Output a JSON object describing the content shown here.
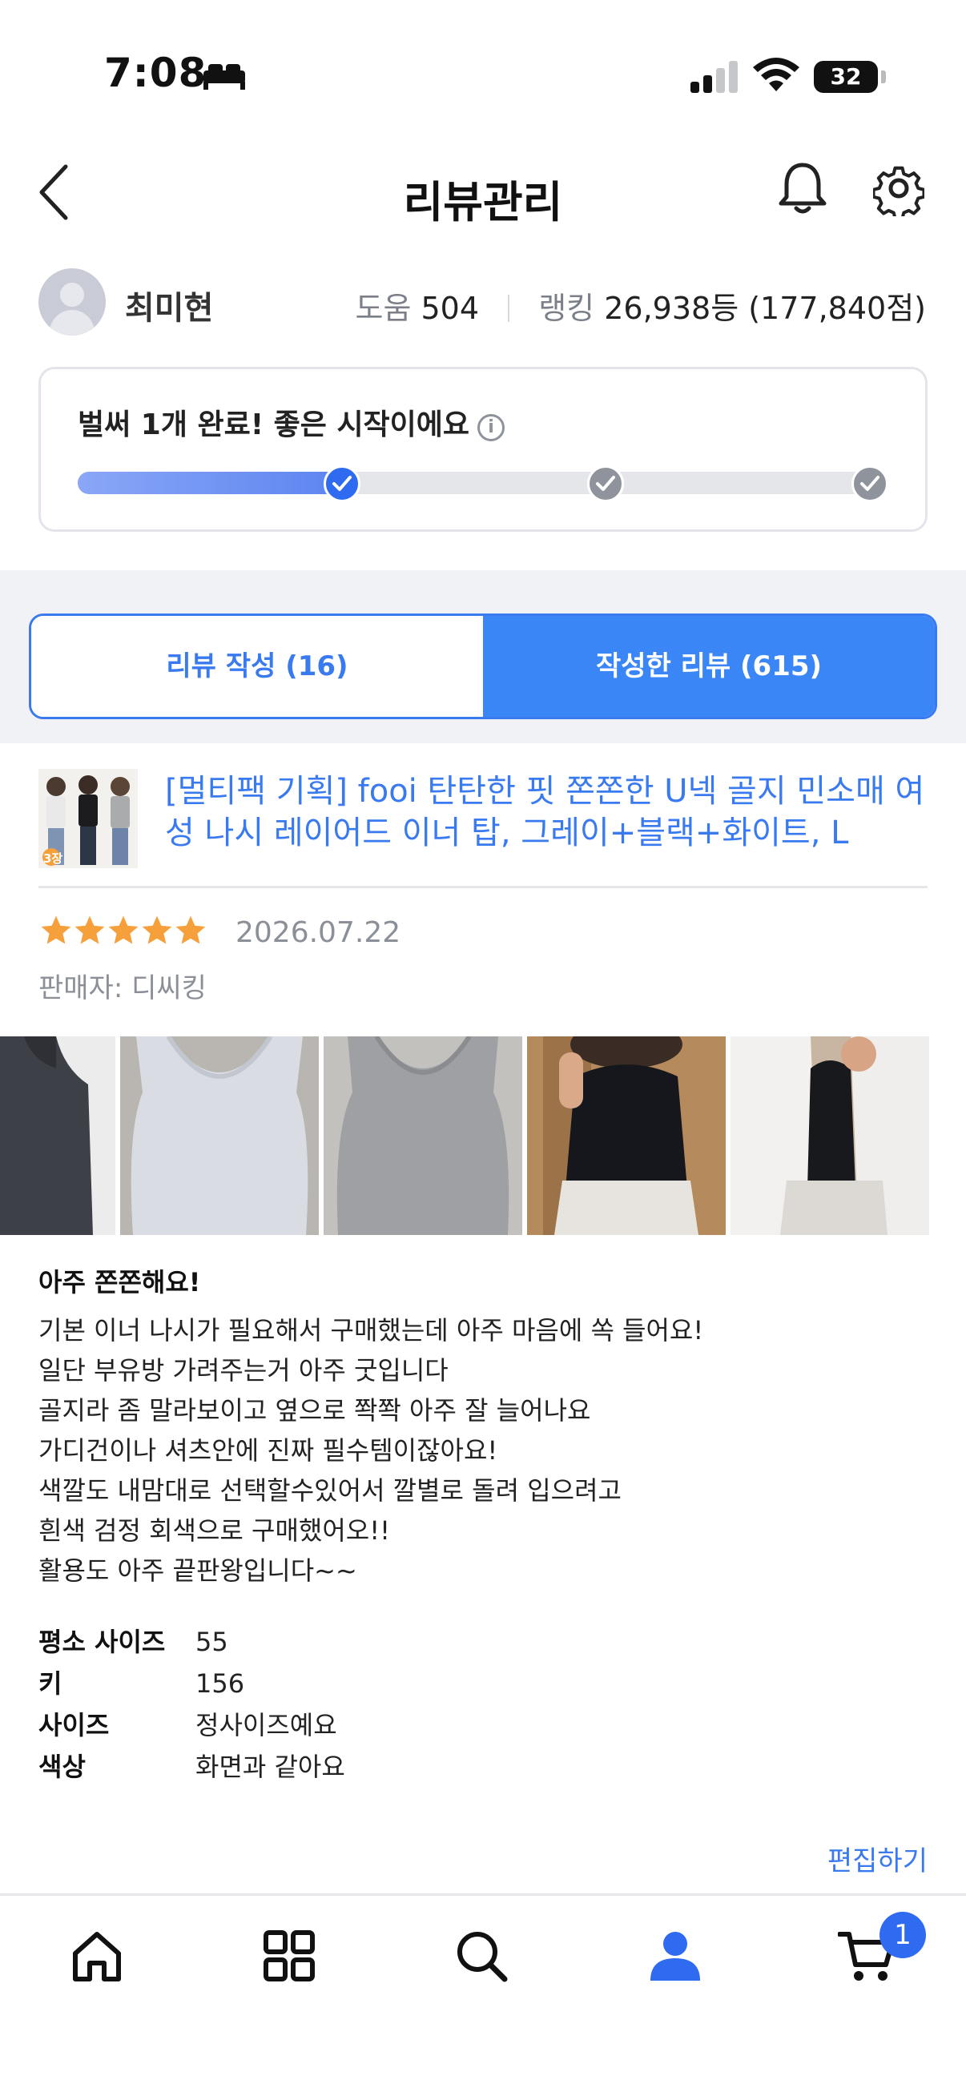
{
  "status_bar": {
    "time": "7:08",
    "battery": "32"
  },
  "header": {
    "title": "리뷰관리"
  },
  "profile": {
    "name": "최미현",
    "help_label": "도움",
    "help_count": "504",
    "ranking_label": "랭킹",
    "ranking_value": "26,938등 (177,840점)"
  },
  "progress": {
    "message": "벌써 1개 완료! 좋은 시작이에요",
    "info_icon": "i",
    "completed_steps": 1,
    "total_steps": 3
  },
  "tabs": {
    "write": "리뷰 작성 (16)",
    "written": "작성한 리뷰 (615)"
  },
  "review": {
    "product_name": "[멀티팩 기획] fooi 탄탄한 핏 쫀쫀한 U넥 골지 민소매 여성 나시 레이어드 이너 탑, 그레이+블랙+화이트, L",
    "thumb_badge": "3장",
    "rating": 5,
    "date": "2026.07.22",
    "seller": "판매자: 디씨킹",
    "title": "아주 쫀쫀해요!",
    "body_lines": [
      "기본 이너 나시가 필요해서 구매했는데 아주 마음에 쏙 들어요!",
      "일단 부유방 가려주는거 아주 굿입니다",
      "골지라 좀 말라보이고 옆으로 쫙쫙 아주 잘 늘어나요",
      "가디건이나 셔츠안에 진짜 필수템이잖아요!",
      "색깔도 내맘대로 선택할수있어서 깔별로 돌려 입으려고",
      "흰색 검정 회색으로 구매했어오!!",
      "활용도 아주 끝판왕입니다~~"
    ],
    "attributes": [
      {
        "key": "평소 사이즈",
        "value": "55"
      },
      {
        "key": "키",
        "value": "156"
      },
      {
        "key": "사이즈",
        "value": "정사이즈예요"
      },
      {
        "key": "색상",
        "value": "화면과 같아요"
      }
    ],
    "edit_label": "편집하기"
  },
  "bottom_nav": {
    "items": [
      "home-icon",
      "category-icon",
      "search-icon",
      "my-icon",
      "cart-icon"
    ],
    "active": "my-icon",
    "cart_badge": "1"
  },
  "colors": {
    "accent": "#3a7af0",
    "star": "#f5a03a",
    "tab_active": "#3a86f7"
  }
}
